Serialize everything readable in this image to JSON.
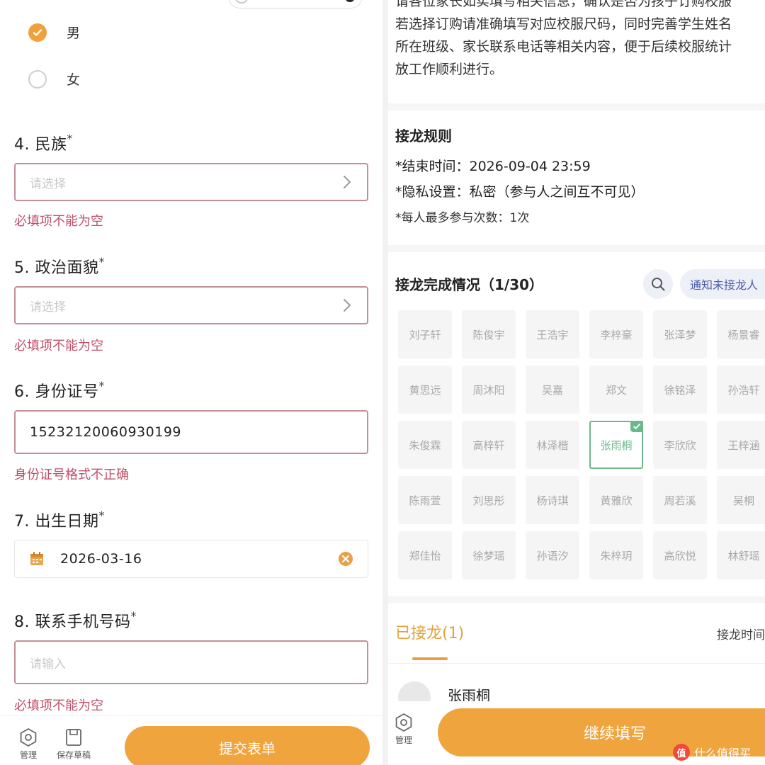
{
  "form": {
    "gender_options": [
      {
        "label": "男",
        "checked": true
      },
      {
        "label": "女",
        "checked": false
      }
    ],
    "required_mark": "*",
    "fields": {
      "ethnicity": {
        "title": "4. 民族",
        "placeholder": "请选择",
        "error": "必填项不能为空"
      },
      "political": {
        "title": "5. 政治面貌",
        "placeholder": "请选择",
        "error": "必填项不能为空"
      },
      "id_number": {
        "title": "6. 身份证号",
        "value": "15232120060930199",
        "error": "身份证号格式不正确"
      },
      "birth_date": {
        "title": "7. 出生日期",
        "value": "2026-03-16"
      },
      "phone": {
        "title": "8. 联系手机号码",
        "placeholder": "请输入",
        "error": "必填项不能为空"
      }
    },
    "bottom_bar": {
      "manage_label": "管理",
      "draft_label": "保存草稿",
      "submit_label": "提交表单"
    }
  },
  "detail": {
    "description_lines": [
      "请各位家长如实填写相关信息，确认是否为孩子订购校服",
      "若选择订购请准确填写对应校服尺码，同时完善学生姓名",
      "所在班级、家长联系电话等相关内容，便于后续校服统计",
      "放工作顺利进行。"
    ],
    "rules": {
      "title": "接龙规则",
      "end_time": "*结束时间：2026-09-04 23:59",
      "privacy": "*隐私设置：私密（参与人之间互不可见）",
      "max_times": "*每人最多参与次数：1次"
    },
    "status": {
      "title": "接龙完成情况（1/30）",
      "notify_label": "通知未接龙人",
      "names": [
        [
          "刘子轩",
          "陈俊宇",
          "王浩宇",
          "李梓豪",
          "张泽梦",
          "杨景睿"
        ],
        [
          "黄思远",
          "周沐阳",
          "吴嘉",
          "郑文",
          "徐铭泽",
          "孙浩轩"
        ],
        [
          "朱俊霖",
          "高梓轩",
          "林泽楷",
          "张雨桐",
          "李欣欣",
          "王梓涵"
        ],
        [
          "陈雨萱",
          "刘思彤",
          "杨诗琪",
          "黄雅欣",
          "周若溪",
          "吴桐"
        ],
        [
          "郑佳怡",
          "徐梦瑶",
          "孙语汐",
          "朱梓玥",
          "高欣悦",
          "林舒瑶"
        ]
      ],
      "completed_name": "张雨桐"
    },
    "done_tab": "已接龙(1)",
    "sort_label": "接龙时间",
    "person": {
      "name": "张雨桐"
    },
    "bottom_bar": {
      "manage_label": "管理",
      "continue_label": "继续填写"
    },
    "watermark": {
      "logo": "值",
      "text": "什么值得买"
    },
    "colors": {
      "accent": "#f0a43e",
      "done": "#6bb88a",
      "error": "#c0506a",
      "link": "#4a5ba8"
    }
  }
}
